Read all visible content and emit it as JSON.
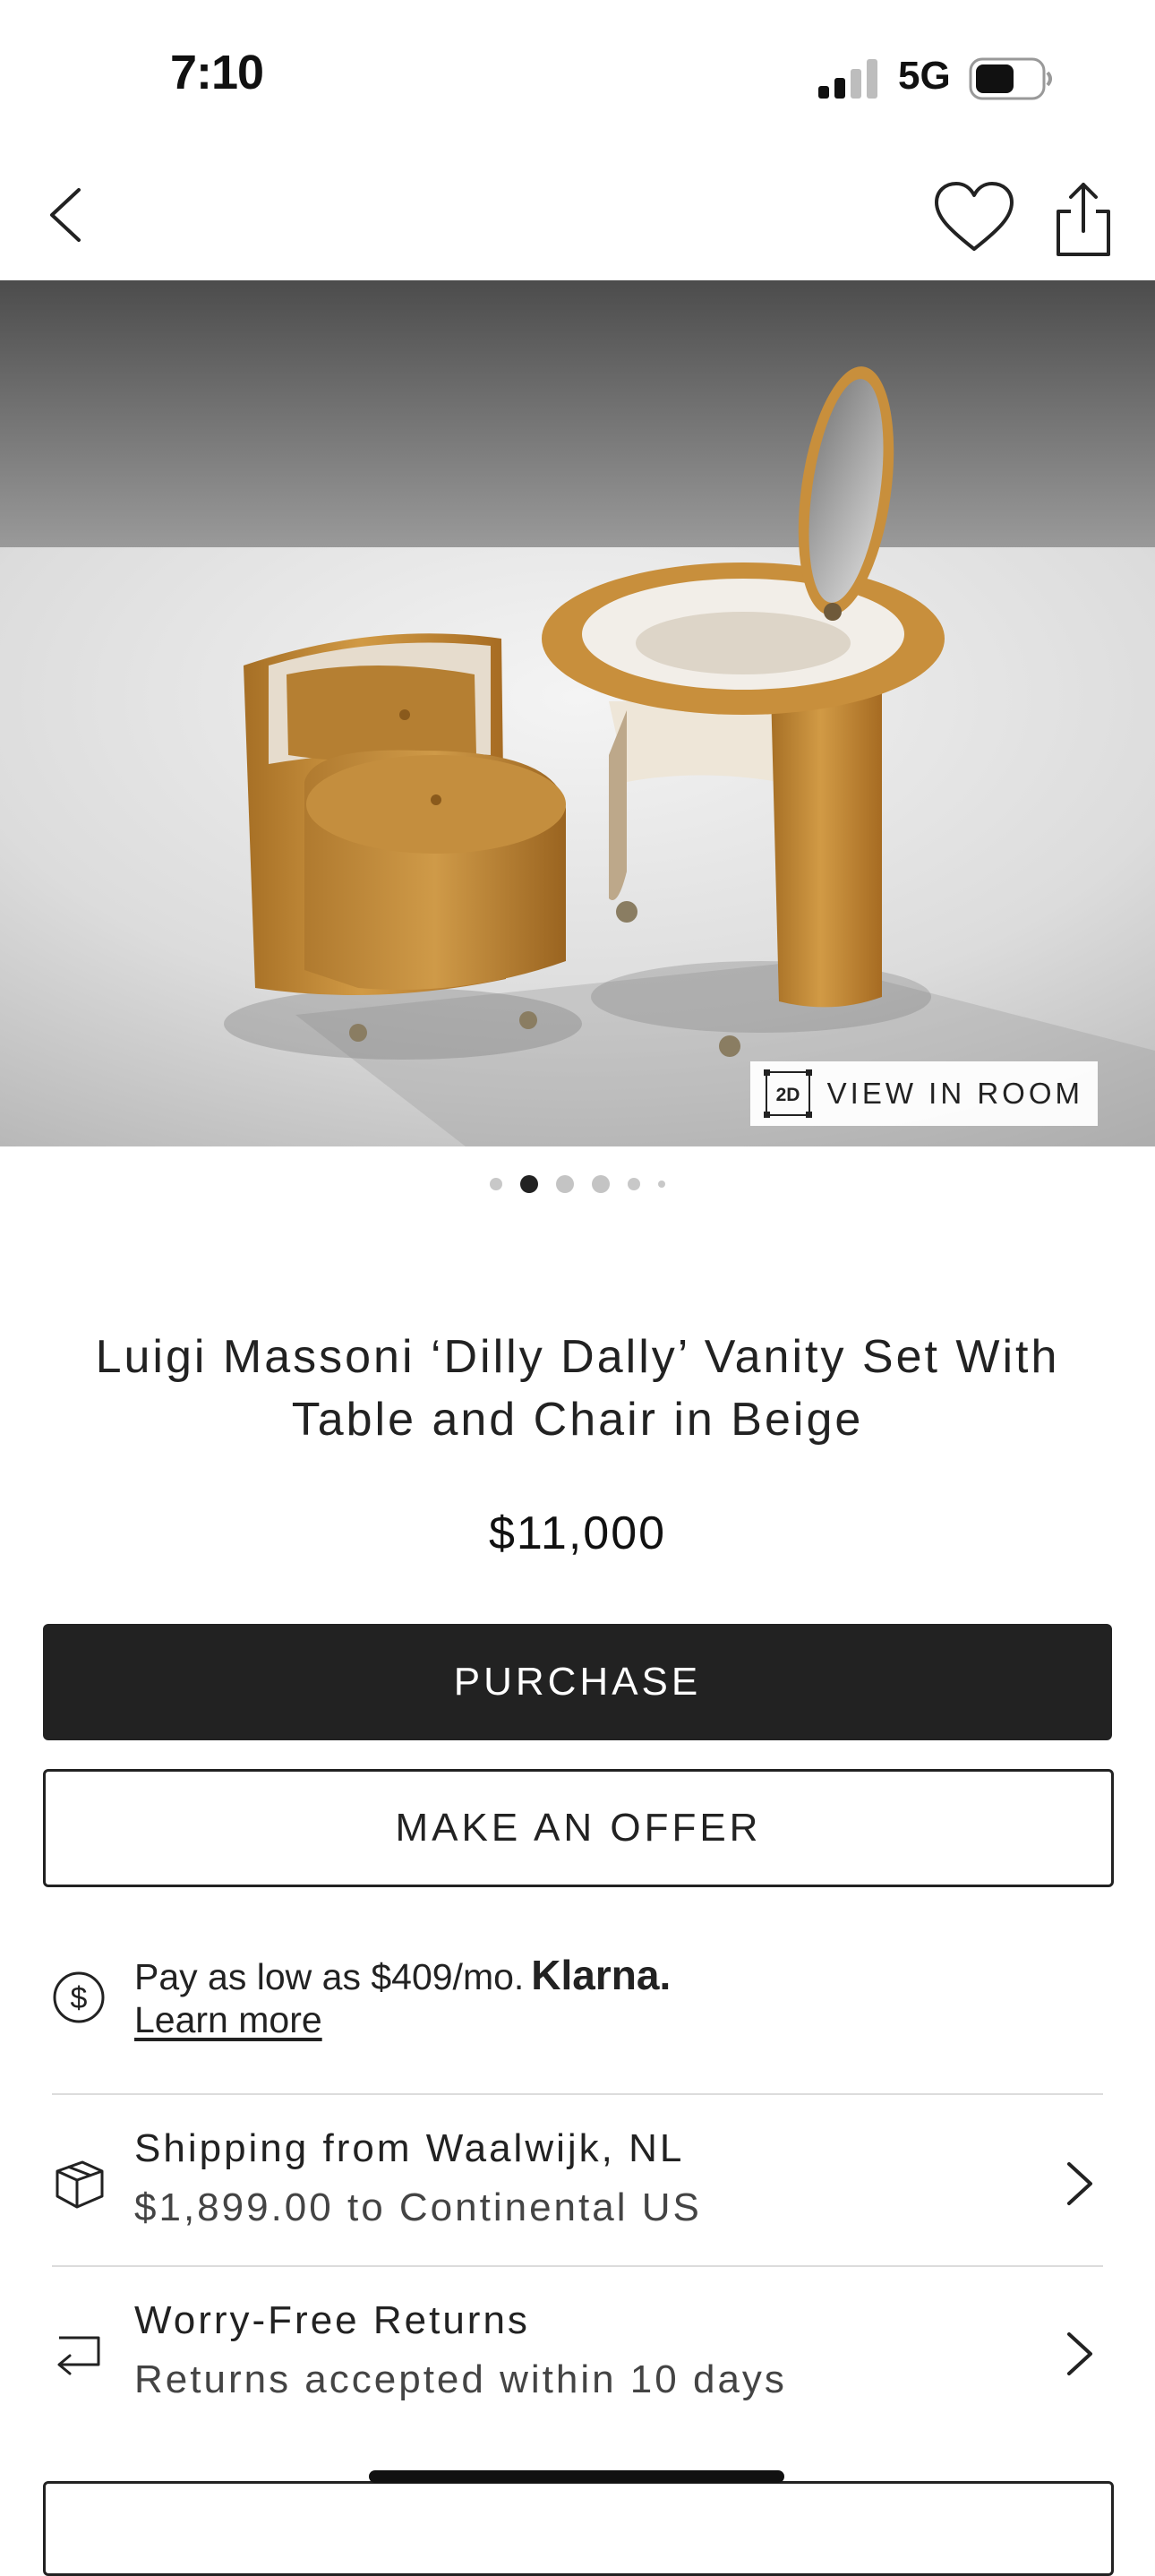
{
  "status_bar": {
    "time": "7:10",
    "network": "5G",
    "signal_bars_active": 2,
    "signal_bars_total": 4,
    "battery_level": 0.6
  },
  "nav": {
    "back_icon": "chevron-left-icon",
    "favorite_icon": "heart-icon",
    "share_icon": "share-icon"
  },
  "hero": {
    "view_in_room_label": "VIEW IN ROOM",
    "view_in_room_badge": "2D",
    "carousel_total": 6,
    "carousel_active_index": 1
  },
  "product": {
    "title": "Luigi Massoni ‘Dilly Dally’ Vanity Set With Table and Chair in Beige",
    "price": "$11,000"
  },
  "actions": {
    "purchase_label": "PURCHASE",
    "offer_label": "MAKE AN OFFER"
  },
  "klarna": {
    "icon": "dollar-circle-icon",
    "text": "Pay as low as $409/mo.",
    "brand": "Klarna.",
    "link": "Learn more"
  },
  "shipping": {
    "icon": "package-icon",
    "title": "Shipping from Waalwijk, NL",
    "subtitle": "$1,899.00 to Continental US"
  },
  "returns": {
    "icon": "return-arrow-icon",
    "title": "Worry-Free Returns",
    "subtitle": "Returns accepted within 10 days"
  },
  "colors": {
    "primary_button": "#222222",
    "text": "#222222",
    "divider": "#dcdcdc",
    "upholstery": "#c8913a"
  }
}
